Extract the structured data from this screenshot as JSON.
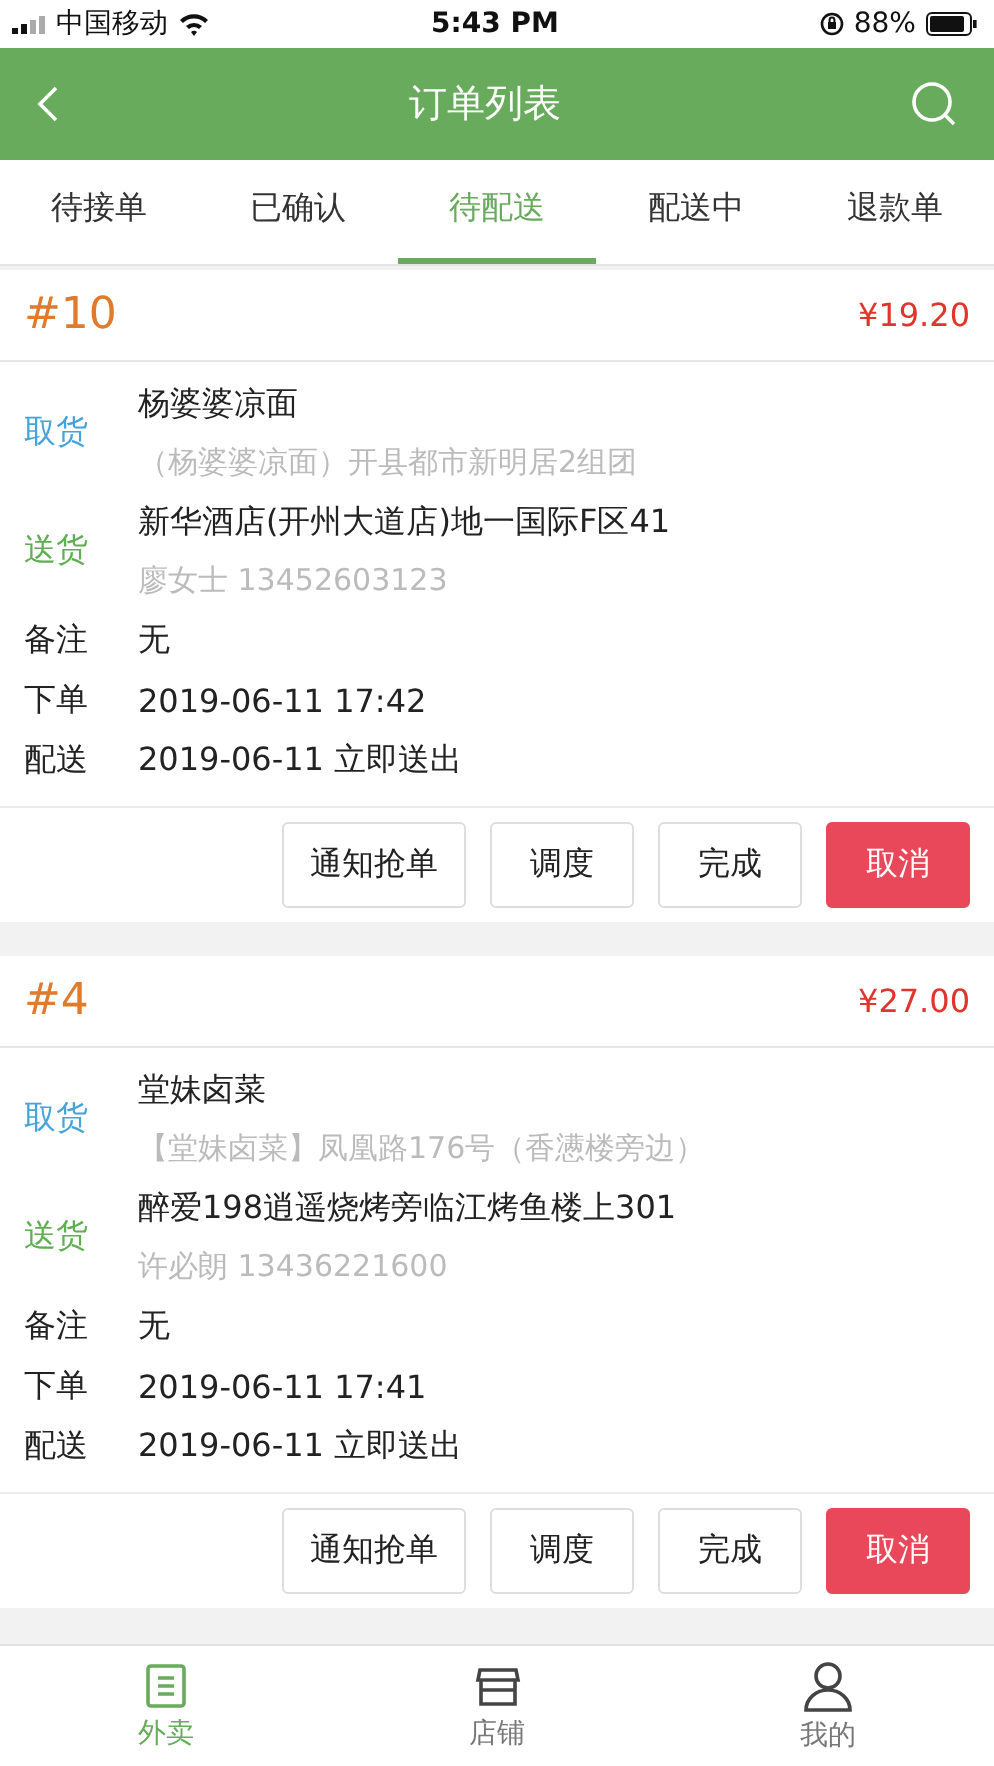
{
  "status_bar": {
    "carrier": "中国移动",
    "time": "5:43 PM",
    "battery": "88%"
  },
  "header": {
    "title": "订单列表"
  },
  "tabs": [
    {
      "label": "待接单",
      "selected": false
    },
    {
      "label": "已确认",
      "selected": false
    },
    {
      "label": "待配送",
      "selected": true
    },
    {
      "label": "配送中",
      "selected": false
    },
    {
      "label": "退款单",
      "selected": false
    }
  ],
  "orders": [
    {
      "number": "#10",
      "price": "¥19.20",
      "pickup": {
        "label": "取货",
        "name": "杨婆婆凉面",
        "address": "（杨婆婆凉面）开县都市新明居2组团"
      },
      "delivery": {
        "label": "送货",
        "address": "新华酒店(开州大道店)地一国际F区41",
        "contact": "廖女士 13452603123"
      },
      "details": [
        {
          "label": "备注",
          "value": "无"
        },
        {
          "label": "下单",
          "value": "2019-06-11 17:42"
        },
        {
          "label": "配送",
          "value": "2019-06-11 立即送出"
        }
      ],
      "actions": [
        {
          "label": "通知抢单",
          "kind": "outline"
        },
        {
          "label": "调度",
          "kind": "outline"
        },
        {
          "label": "完成",
          "kind": "outline"
        },
        {
          "label": "取消",
          "kind": "danger"
        }
      ]
    },
    {
      "number": "#4",
      "price": "¥27.00",
      "pickup": {
        "label": "取货",
        "name": "堂妹卤菜",
        "address": "【堂妹卤菜】凤凰路176号（香懑楼旁边）"
      },
      "delivery": {
        "label": "送货",
        "address": "醉爱198逍遥烧烤旁临江烤鱼楼上301",
        "contact": "许必朗 13436221600"
      },
      "details": [
        {
          "label": "备注",
          "value": "无"
        },
        {
          "label": "下单",
          "value": "2019-06-11 17:41"
        },
        {
          "label": "配送",
          "value": "2019-06-11 立即送出"
        }
      ],
      "actions": [
        {
          "label": "通知抢单",
          "kind": "outline"
        },
        {
          "label": "调度",
          "kind": "outline"
        },
        {
          "label": "完成",
          "kind": "outline"
        },
        {
          "label": "取消",
          "kind": "danger"
        }
      ]
    }
  ],
  "bottom_nav": [
    {
      "label": "外卖",
      "kind": "list",
      "selected": true
    },
    {
      "label": "店铺",
      "kind": "store",
      "selected": false
    },
    {
      "label": "我的",
      "kind": "person",
      "selected": false
    }
  ]
}
